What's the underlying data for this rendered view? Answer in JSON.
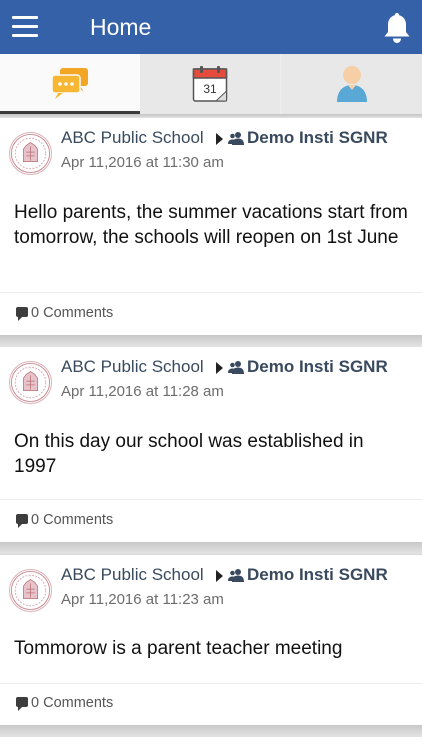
{
  "header": {
    "title": "Home",
    "menu_icon": "hamburger-menu-icon",
    "bell_icon": "bell-icon"
  },
  "tabs": [
    {
      "icon": "chat-bubbles-icon",
      "active": true
    },
    {
      "icon": "calendar-icon",
      "day": "31",
      "active": false
    },
    {
      "icon": "profile-icon",
      "active": false
    }
  ],
  "posts": [
    {
      "school": "ABC Public School",
      "group": "Demo Insti SGNR",
      "date": "Apr 11,2016 at 11:30 am",
      "message": "Hello parents, the summer vacations start from tomorrow, the schools will reopen on 1st June",
      "comments": "0 Comments"
    },
    {
      "school": "ABC Public School",
      "group": "Demo Insti SGNR",
      "date": "Apr 11,2016 at 11:28 am",
      "message": "On this day our school was established in 1997",
      "comments": "0 Comments"
    },
    {
      "school": "ABC Public School",
      "group": "Demo Insti SGNR",
      "date": "Apr 11,2016 at 11:23 am",
      "message": "Tommorow is a parent teacher meeting",
      "comments": "0 Comments"
    }
  ],
  "colors": {
    "app_bar": "#3561a9",
    "accent_orange": "#f2a623",
    "calendar_red": "#e64c3c",
    "avatar_blue": "#5aa8d6"
  }
}
